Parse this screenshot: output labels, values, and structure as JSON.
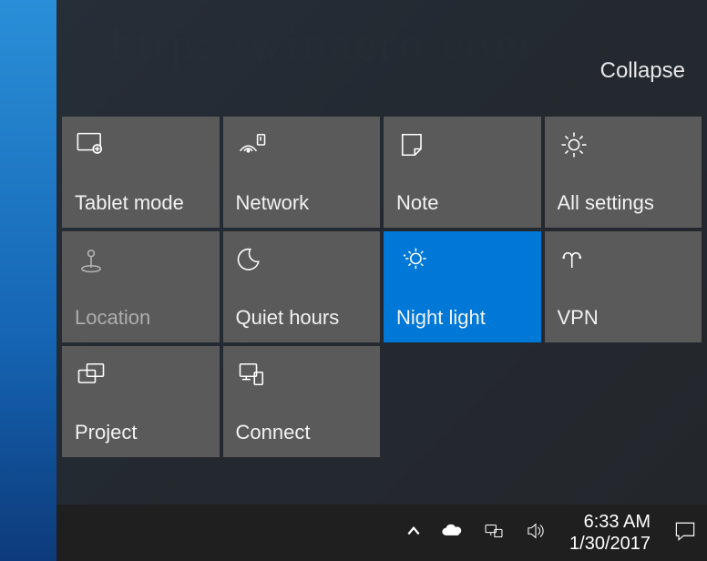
{
  "watermark": "http://winaero.com",
  "actionCenter": {
    "collapseLabel": "Collapse",
    "tiles": [
      {
        "id": "tablet-mode",
        "label": "Tablet mode",
        "active": false,
        "dim": false
      },
      {
        "id": "network",
        "label": "Network",
        "active": false,
        "dim": false
      },
      {
        "id": "note",
        "label": "Note",
        "active": false,
        "dim": false
      },
      {
        "id": "all-settings",
        "label": "All settings",
        "active": false,
        "dim": false
      },
      {
        "id": "location",
        "label": "Location",
        "active": false,
        "dim": true
      },
      {
        "id": "quiet-hours",
        "label": "Quiet hours",
        "active": false,
        "dim": false
      },
      {
        "id": "night-light",
        "label": "Night light",
        "active": true,
        "dim": false
      },
      {
        "id": "vpn",
        "label": "VPN",
        "active": false,
        "dim": false
      },
      {
        "id": "project",
        "label": "Project",
        "active": false,
        "dim": false
      },
      {
        "id": "connect",
        "label": "Connect",
        "active": false,
        "dim": false
      }
    ]
  },
  "taskbar": {
    "time": "6:33 AM",
    "date": "1/30/2017"
  }
}
